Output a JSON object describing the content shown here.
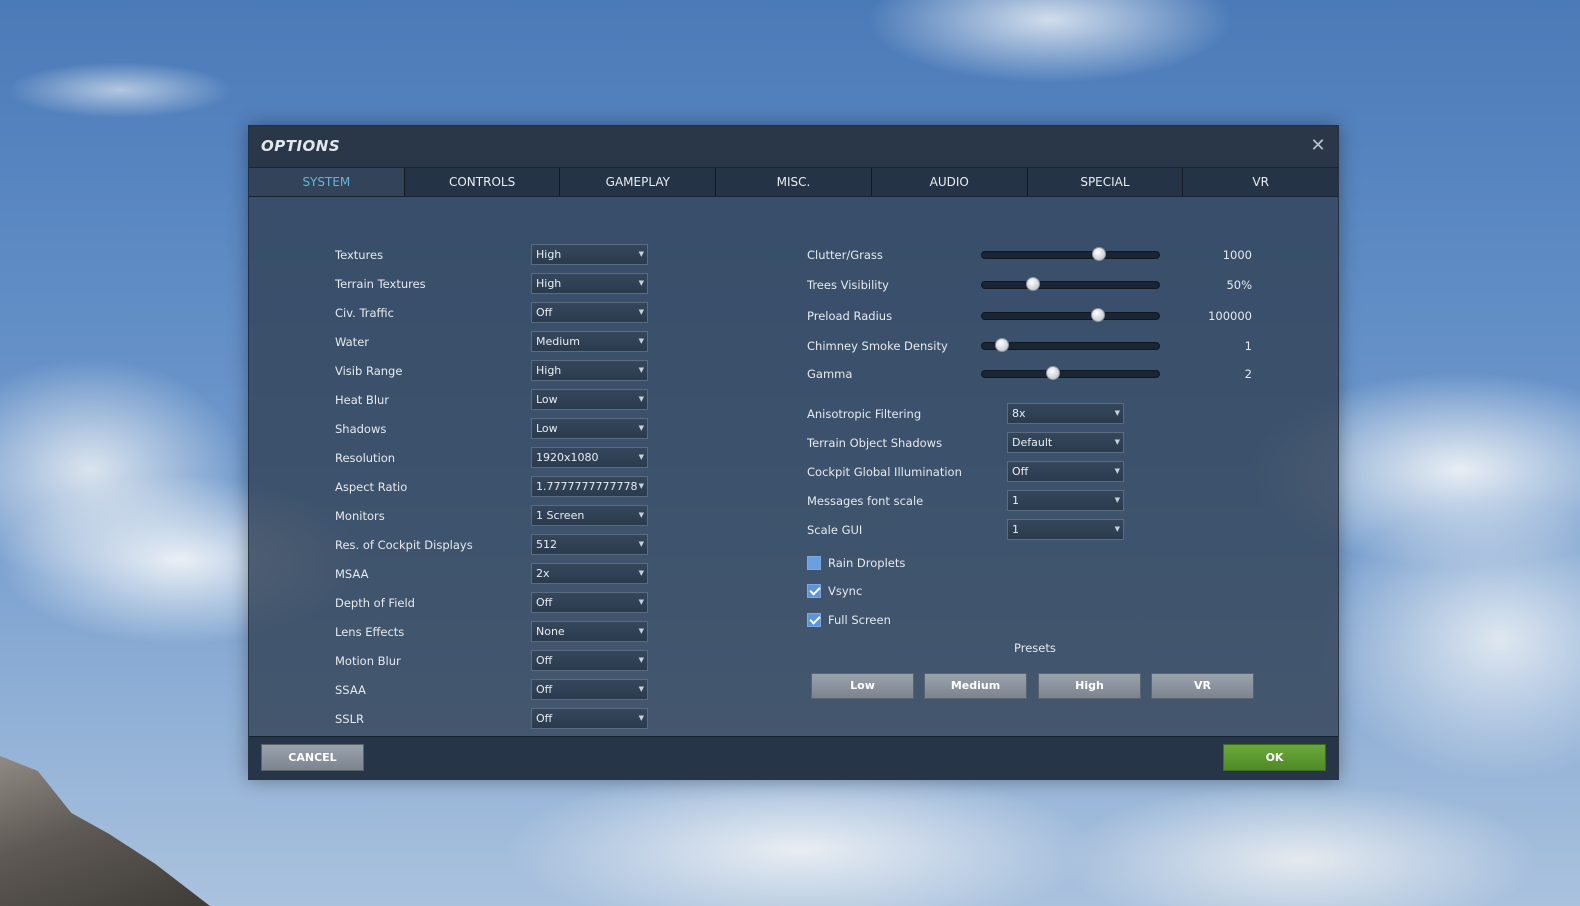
{
  "dialog": {
    "title": "OPTIONS",
    "close_glyph": "✕"
  },
  "tabs": [
    {
      "label": "SYSTEM",
      "active": true
    },
    {
      "label": "CONTROLS"
    },
    {
      "label": "GAMEPLAY"
    },
    {
      "label": "MISC."
    },
    {
      "label": "AUDIO"
    },
    {
      "label": "SPECIAL"
    },
    {
      "label": "VR"
    }
  ],
  "left_settings": [
    {
      "label": "Textures",
      "value": "High"
    },
    {
      "label": "Terrain Textures",
      "value": "High"
    },
    {
      "label": "Civ. Traffic",
      "value": "Off"
    },
    {
      "label": "Water",
      "value": "Medium"
    },
    {
      "label": "Visib Range",
      "value": "High"
    },
    {
      "label": "Heat Blur",
      "value": "Low"
    },
    {
      "label": "Shadows",
      "value": "Low"
    },
    {
      "label": "Resolution",
      "value": "1920x1080"
    },
    {
      "label": "Aspect Ratio",
      "value": "1.7777777777778"
    },
    {
      "label": "Monitors",
      "value": "1 Screen"
    },
    {
      "label": "Res. of Cockpit Displays",
      "value": "512"
    },
    {
      "label": "MSAA",
      "value": "2x"
    },
    {
      "label": "Depth of Field",
      "value": "Off"
    },
    {
      "label": "Lens Effects",
      "value": "None"
    },
    {
      "label": "Motion Blur",
      "value": "Off"
    },
    {
      "label": "SSAA",
      "value": "Off"
    },
    {
      "label": "SSLR",
      "value": "Off"
    }
  ],
  "sliders": [
    {
      "label": "Clutter/Grass",
      "display": "1000",
      "fraction": 0.66
    },
    {
      "label": "Trees Visibility",
      "display": "50%",
      "fraction": 0.29
    },
    {
      "label": "Preload Radius",
      "display": "100000",
      "fraction": 0.655
    },
    {
      "label": "Chimney Smoke Density",
      "display": "1",
      "fraction": 0.115
    },
    {
      "label": "Gamma",
      "display": "2",
      "fraction": 0.4
    }
  ],
  "right_settings": [
    {
      "label": "Anisotropic Filtering",
      "value": "8x"
    },
    {
      "label": "Terrain Object Shadows",
      "value": "Default"
    },
    {
      "label": "Cockpit Global Illumination",
      "value": "Off"
    },
    {
      "label": "Messages font scale",
      "value": "1"
    },
    {
      "label": "Scale GUI",
      "value": "1"
    }
  ],
  "checkboxes": [
    {
      "label": "Rain Droplets",
      "checked": false
    },
    {
      "label": "Vsync",
      "checked": true
    },
    {
      "label": "Full Screen",
      "checked": true
    }
  ],
  "presets": {
    "title": "Presets",
    "buttons": [
      "Low",
      "Medium",
      "High",
      "VR"
    ]
  },
  "footer": {
    "cancel_label": "CANCEL",
    "ok_label": "OK"
  },
  "colors": {
    "active_tab": "#5fb8dc",
    "ok_button": "#5a9830",
    "checkbox": "#5e94d8"
  },
  "dropdown_arrow_icon": "▼"
}
